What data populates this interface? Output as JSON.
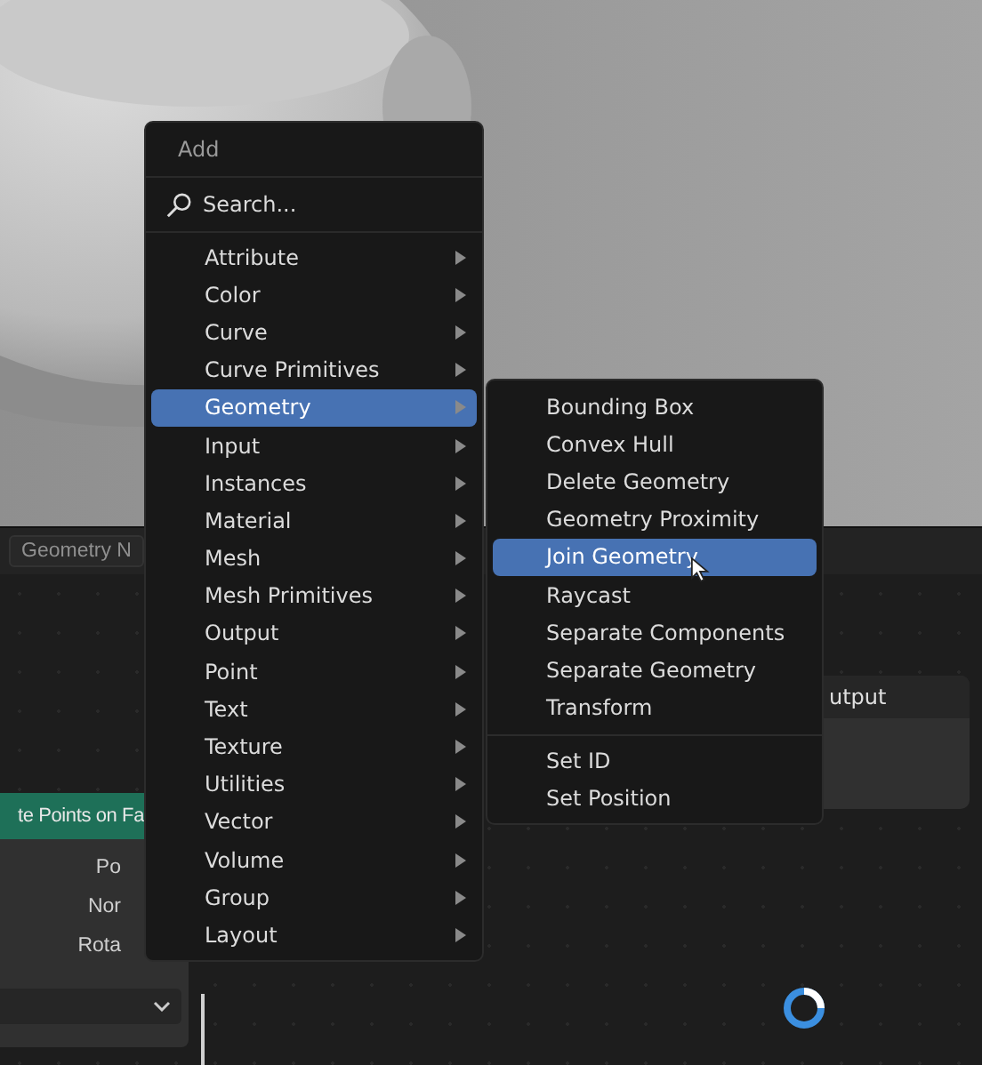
{
  "node_editor": {
    "header_tab": "Geometry N",
    "left_node": {
      "title": "te Points on Fa",
      "sockets": [
        "Po",
        "Nor",
        "Rota"
      ]
    },
    "right_node": {
      "title": "utput"
    }
  },
  "add_menu": {
    "title": "Add",
    "search": "Search...",
    "items": [
      {
        "label": "Attribute",
        "selected": false
      },
      {
        "label": "Color",
        "selected": false
      },
      {
        "label": "Curve",
        "selected": false
      },
      {
        "label": "Curve Primitives",
        "selected": false
      },
      {
        "label": "Geometry",
        "selected": true
      },
      {
        "label": "Input",
        "selected": false
      },
      {
        "label": "Instances",
        "selected": false
      },
      {
        "label": "Material",
        "selected": false
      },
      {
        "label": "Mesh",
        "selected": false
      },
      {
        "label": "Mesh Primitives",
        "selected": false
      },
      {
        "label": "Output",
        "selected": false
      },
      {
        "label": "Point",
        "selected": false
      },
      {
        "label": "Text",
        "selected": false
      },
      {
        "label": "Texture",
        "selected": false
      },
      {
        "label": "Utilities",
        "selected": false
      },
      {
        "label": "Vector",
        "selected": false
      },
      {
        "label": "Volume",
        "selected": false
      },
      {
        "label": "Group",
        "selected": false
      },
      {
        "label": "Layout",
        "selected": false
      }
    ]
  },
  "geometry_submenu": {
    "groups": [
      [
        {
          "label": "Bounding Box",
          "selected": false
        },
        {
          "label": "Convex Hull",
          "selected": false
        },
        {
          "label": "Delete Geometry",
          "selected": false
        },
        {
          "label": "Geometry Proximity",
          "selected": false
        },
        {
          "label": "Join Geometry",
          "selected": true
        },
        {
          "label": "Raycast",
          "selected": false
        },
        {
          "label": "Separate Components",
          "selected": false
        },
        {
          "label": "Separate Geometry",
          "selected": false
        },
        {
          "label": "Transform",
          "selected": false
        }
      ],
      [
        {
          "label": "Set ID",
          "selected": false
        },
        {
          "label": "Set Position",
          "selected": false
        }
      ]
    ]
  }
}
